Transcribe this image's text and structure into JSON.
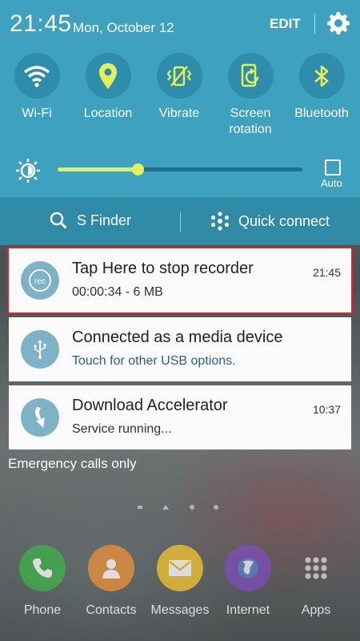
{
  "status_bar": {
    "time": "21:45",
    "date": "Mon, October 12",
    "edit_label": "EDIT",
    "settings_icon": "gear-icon"
  },
  "quick_settings": [
    {
      "label": "Wi-Fi",
      "icon": "wifi-icon"
    },
    {
      "label": "Location",
      "icon": "location-pin-icon"
    },
    {
      "label": "Vibrate",
      "icon": "vibrate-icon"
    },
    {
      "label": "Screen\nrotation",
      "icon": "screen-rotation-icon"
    },
    {
      "label": "Bluetooth",
      "icon": "bluetooth-icon"
    }
  ],
  "brightness": {
    "level": 0.33,
    "auto_label": "Auto",
    "icon": "brightness-icon"
  },
  "finder_bar": {
    "s_finder_label": "S Finder",
    "quick_connect_label": "Quick connect"
  },
  "notifications": [
    {
      "title": "Tap Here to stop recorder",
      "subtitle": "00:00:34 - 6 MB",
      "time": "21:45",
      "icon": "rec-icon",
      "highlighted": true
    },
    {
      "title": "Connected as a media device",
      "subtitle": "Touch for other USB options.",
      "time": "",
      "icon": "usb-icon",
      "highlighted": false
    },
    {
      "title": "Download Accelerator",
      "subtitle": "Service running...",
      "time": "10:37",
      "icon": "download-accelerator-icon",
      "highlighted": false
    }
  ],
  "lock_screen": {
    "emergency_text": "Emergency calls only"
  },
  "dock": [
    {
      "label": "Phone",
      "icon": "phone-icon",
      "color": "#3fb04a"
    },
    {
      "label": "Contacts",
      "icon": "contacts-icon",
      "color": "#e8913a"
    },
    {
      "label": "Messages",
      "icon": "messages-icon",
      "color": "#f2c230"
    },
    {
      "label": "Internet",
      "icon": "internet-icon",
      "color": "#7b4fb8"
    },
    {
      "label": "Apps",
      "icon": "apps-grid-icon",
      "color": "#888888"
    }
  ],
  "colors": {
    "shade_bg": "#3ea1be",
    "finder_bg": "#2f8aa5",
    "slider_accent": "#e3f05a",
    "highlight_border": "#e1202c"
  }
}
